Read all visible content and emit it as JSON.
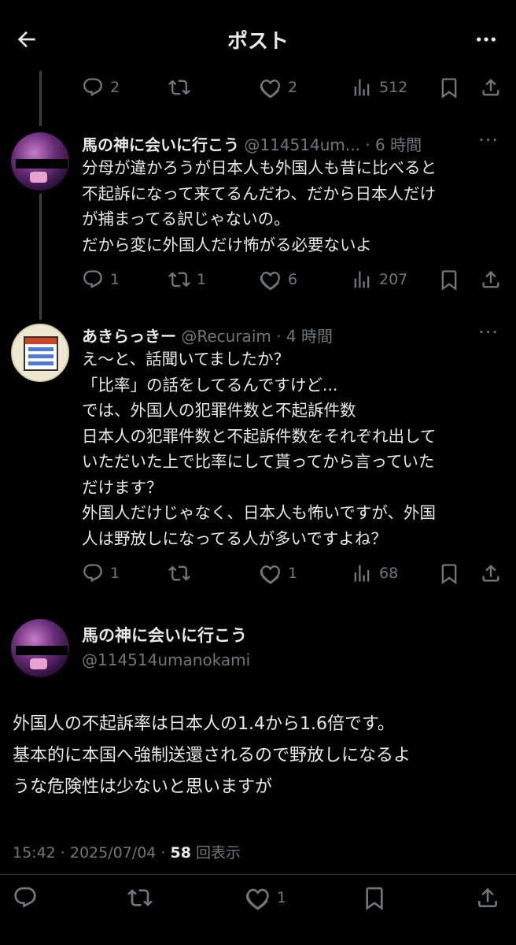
{
  "header": {
    "title": "ポスト"
  },
  "top_actions": {
    "replies": "2",
    "retweets": "",
    "likes": "2",
    "views": "512"
  },
  "post1": {
    "name": "馬の神に会いに行こう",
    "handle": "@114514um...",
    "time": "· 6 時間",
    "text": "分母が違かろうが日本人も外国人も昔に比べると\n不起訴になって来てるんだわ、だから日本人だけ\nが捕まってる訳じゃないの。\nだから変に外国人だけ怖がる必要ないよ",
    "actions": {
      "replies": "1",
      "retweets": "1",
      "likes": "6",
      "views": "207"
    }
  },
  "post2": {
    "name": "あきらっきー",
    "handle": "@Recuraim",
    "time": "· 4 時間",
    "text": "え〜と、話聞いてましたか？\n「比率」の話をしてるんですけど...\nでは、外国人の犯罪件数と不起訴件数\n日本人の犯罪件数と不起訴件数をそれぞれ出して\nいただいた上で比率にして貰ってから言っていた\nだけます？\n外国人だけじゃなく、日本人も怖いですが、外国\n人は野放しになってる人が多いですよね？",
    "actions": {
      "replies": "1",
      "retweets": "",
      "likes": "1",
      "views": "68"
    }
  },
  "main_post": {
    "name": "馬の神に会いに行こう",
    "handle": "@114514umanokami",
    "text": "外国人の不起訴率は日本人の1.4から1.6倍です。\n基本的に本国へ強制送還されるので野放しになるよ\nうな危険性は少ないと思いますが",
    "timestamp": "15:42 · 2025/07/04 · ",
    "views_count": "58",
    "views_label": " 回表示",
    "actions": {
      "replies": "",
      "retweets": "",
      "likes": "1"
    }
  },
  "icons": [
    "back-arrow-icon",
    "more-icon",
    "reply-icon",
    "retweet-icon",
    "like-icon",
    "views-icon",
    "bookmark-icon",
    "share-icon"
  ]
}
